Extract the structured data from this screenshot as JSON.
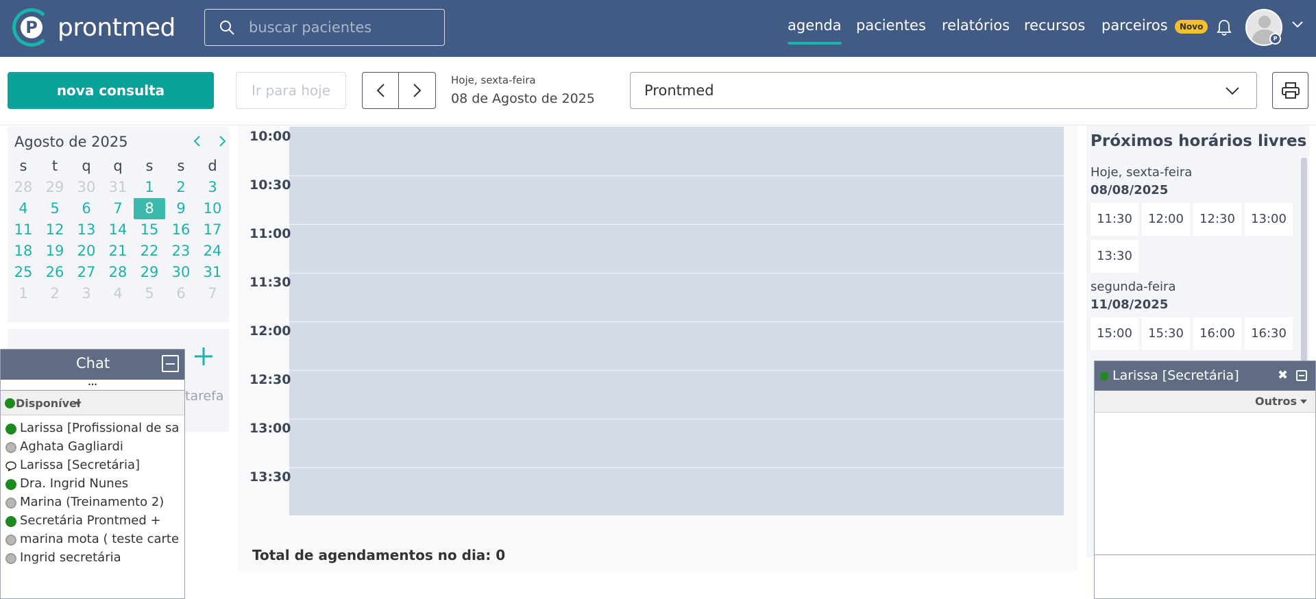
{
  "brand": {
    "logo_text": "prontmed",
    "logo_letter": "P"
  },
  "search": {
    "placeholder": "buscar pacientes"
  },
  "nav": {
    "items": [
      "agenda",
      "pacientes",
      "relatórios",
      "recursos",
      "parceiros"
    ],
    "active": "agenda",
    "badge": "Novo"
  },
  "user": {
    "badge_letter": "P"
  },
  "toolbar": {
    "new_label": "nova consulta",
    "today_label": "Ir para hoje",
    "date_caption": "Hoje, sexta-feira",
    "date_full": "08 de Agosto de 2025",
    "professional": "Prontmed"
  },
  "calendar": {
    "title": "Agosto de 2025",
    "weekdays": [
      "s",
      "t",
      "q",
      "q",
      "s",
      "s",
      "d"
    ],
    "weeks": [
      [
        [
          "28",
          "other"
        ],
        [
          "29",
          "other"
        ],
        [
          "30",
          "other"
        ],
        [
          "31",
          "other"
        ],
        [
          "1",
          "cur"
        ],
        [
          "2",
          "cur"
        ],
        [
          "3",
          "cur"
        ]
      ],
      [
        [
          "4",
          "cur"
        ],
        [
          "5",
          "cur"
        ],
        [
          "6",
          "cur"
        ],
        [
          "7",
          "cur"
        ],
        [
          "8",
          "sel"
        ],
        [
          "9",
          "cur"
        ],
        [
          "10",
          "cur"
        ]
      ],
      [
        [
          "11",
          "cur"
        ],
        [
          "12",
          "cur"
        ],
        [
          "13",
          "cur"
        ],
        [
          "14",
          "cur"
        ],
        [
          "15",
          "cur"
        ],
        [
          "16",
          "cur"
        ],
        [
          "17",
          "cur"
        ]
      ],
      [
        [
          "18",
          "cur"
        ],
        [
          "19",
          "cur"
        ],
        [
          "20",
          "cur"
        ],
        [
          "21",
          "cur"
        ],
        [
          "22",
          "cur"
        ],
        [
          "23",
          "cur"
        ],
        [
          "24",
          "cur"
        ]
      ],
      [
        [
          "25",
          "cur"
        ],
        [
          "26",
          "cur"
        ],
        [
          "27",
          "cur"
        ],
        [
          "28",
          "cur"
        ],
        [
          "29",
          "cur"
        ],
        [
          "30",
          "cur"
        ],
        [
          "31",
          "cur"
        ]
      ],
      [
        [
          "1",
          "other"
        ],
        [
          "2",
          "other"
        ],
        [
          "3",
          "other"
        ],
        [
          "4",
          "other"
        ],
        [
          "5",
          "other"
        ],
        [
          "6",
          "other"
        ],
        [
          "7",
          "other"
        ]
      ]
    ]
  },
  "tasks": {
    "text_fragment": "tarefa"
  },
  "schedule": {
    "times": [
      "10:00",
      "10:30",
      "11:00",
      "11:30",
      "12:00",
      "12:30",
      "13:00",
      "13:30"
    ],
    "total_label": "Total de agendamentos no dia: 0"
  },
  "free_slots": {
    "title": "Próximos horários livres",
    "days": [
      {
        "label": "Hoje, sexta-feira",
        "date": "08/08/2025",
        "slots": [
          "11:30",
          "12:00",
          "12:30",
          "13:00",
          "13:30"
        ]
      },
      {
        "label": "segunda-feira",
        "date": "11/08/2025",
        "slots": [
          "15:00",
          "15:30",
          "16:00",
          "16:30"
        ]
      }
    ]
  },
  "chat": {
    "title": "Chat",
    "dots": "...",
    "status": "Disponível",
    "contacts": [
      {
        "name": "Larissa [Profissional de sa",
        "status": "online"
      },
      {
        "name": "Aghata Gagliardi",
        "status": "offline"
      },
      {
        "name": "Larissa [Secretária]",
        "status": "chatting"
      },
      {
        "name": "Dra. Ingrid Nunes",
        "status": "online"
      },
      {
        "name": "Marina (Treinamento 2)",
        "status": "offline"
      },
      {
        "name": "Secretária Prontmed +",
        "status": "online"
      },
      {
        "name": "marina mota ( teste carte",
        "status": "offline"
      },
      {
        "name": "Ingrid secretária",
        "status": "offline"
      }
    ]
  },
  "conversation": {
    "name": "Larissa [Secretária]",
    "close": "✖",
    "filter": "Outros"
  },
  "colors": {
    "topbar": "#425b85",
    "accent": "#08a29b",
    "schedule_bg": "#d5dbe6",
    "online": "#1d8a1d"
  }
}
